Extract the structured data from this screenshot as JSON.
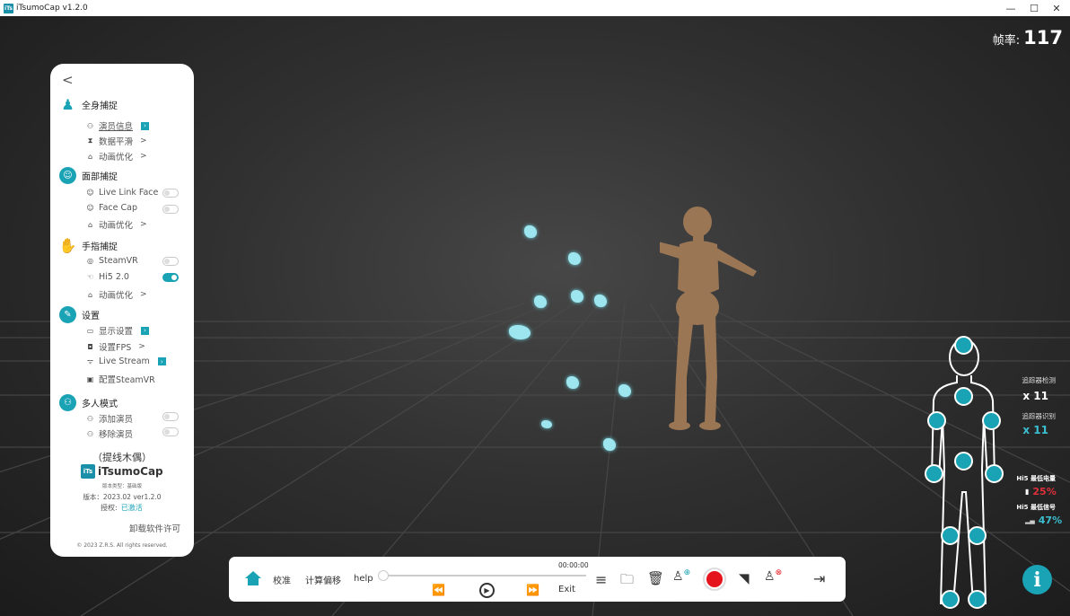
{
  "window": {
    "title": "iTsumoCap v1.2.0",
    "logo_text": "iTs"
  },
  "fps": {
    "label": "帧率:",
    "value": "117"
  },
  "panel": {
    "back_icon": "chevron-left-icon",
    "sections": [
      {
        "title": "全身捕捉",
        "items": [
          "演员信息",
          "数据平滑",
          "动画优化"
        ]
      },
      {
        "title": "面部捕捉",
        "items": [
          "Live Link Face",
          "Face Cap",
          "动画优化"
        ]
      },
      {
        "title": "手指捕捉",
        "items": [
          "SteamVR",
          "Hi5 2.0",
          "动画优化"
        ]
      },
      {
        "title": "设置",
        "items": [
          "显示设置",
          "设置FPS",
          "Live Stream",
          "配置SteamVR"
        ]
      },
      {
        "title": "多人模式",
        "items": [
          "添加演员",
          "移除演员"
        ]
      }
    ],
    "mode": "（提线木偶）",
    "brand": "iTsumoCap",
    "edition": "版本类型：基础版",
    "version": "版本：2023.02  ver1.2.0",
    "license_label": "授权:",
    "license_value": "已激活",
    "uninstall": "卸载软件许可",
    "copyright": "© 2023  Z.R.S.   All rights reserved."
  },
  "right_info": {
    "tracker_detect_label": "追踪器检测",
    "tracker_detect_value": "x 11",
    "tracker_recognize_label": "追踪器识别",
    "tracker_recognize_value": "x 11",
    "hi5_battery_label": "Hi5 最低电量",
    "hi5_battery_value": "25%",
    "hi5_signal_label": "Hi5 最低信号",
    "hi5_signal_value": "47%"
  },
  "toolbar": {
    "calibrate": "校准",
    "compute_offset": "计算偏移",
    "help": "help",
    "time": "00:00:00",
    "exit": "Exit"
  },
  "colors": {
    "accent": "#1aa3b4",
    "record": "#e5141c",
    "battery_low": "#e0303a",
    "signal": "#3bbfd0"
  }
}
